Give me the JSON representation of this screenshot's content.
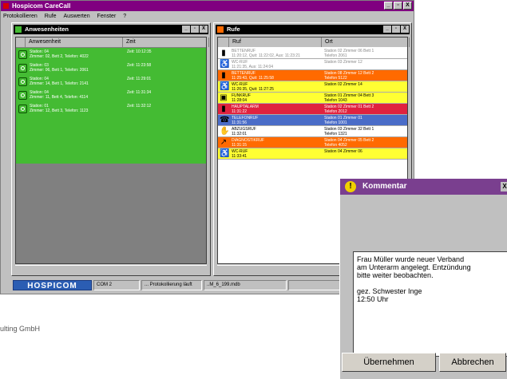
{
  "app": {
    "title": "Hospicom CareCall",
    "window_buttons": [
      "_",
      "▫",
      "X"
    ]
  },
  "menu": [
    "Protokollieren",
    "Rufe",
    "Auswerten",
    "Fenster",
    "?"
  ],
  "anwesenheiten": {
    "title": "Anwesenheiten",
    "columns": [
      "Anwesenheit",
      "Zeit"
    ],
    "rows": [
      {
        "line1": "Station: 04",
        "line2": "Zimmer: 02, Bett 2, Telefon: 4022",
        "time": "Zeit: 10:12:35"
      },
      {
        "line1": "Station: 03",
        "line2": "Zimmer: 06, Bett 1, Telefon: 2061",
        "time": "Zeit: 11:23:58"
      },
      {
        "line1": "Station: 04",
        "line2": "Zimmer: 14, Bett 1, Telefon: 2141",
        "time": "Zeit: 11:29:01"
      },
      {
        "line1": "Station: 04",
        "line2": "Zimmer: 11, Bett 4, Telefon: 4114",
        "time": "Zeit: 11:31:34"
      },
      {
        "line1": "Station: 01",
        "line2": "Zimmer: 12, Bett 3, Telefon: 1123",
        "time": "Zeit: 11:32:12"
      }
    ],
    "color": "#44bb33"
  },
  "rufe": {
    "title": "Rufe",
    "columns": [
      "Ruf",
      "Ort"
    ],
    "rows": [
      {
        "icon": "bed-icon",
        "glyph": "▮",
        "l1": "BETTENRUF",
        "l2": "11:20:12, Quit: 11:22:02, Aus: 11:23:21",
        "o1": "Station 02  Zimmer 06    Bett 1",
        "o2": "Telefon 2061",
        "bg": "#ffffff",
        "fg": "#888888"
      },
      {
        "icon": "toilet-icon",
        "glyph": "♿",
        "l1": "WC-RUF",
        "l2": "11:21:35, Aus: 11:24:04",
        "o1": "Station 03  Zimmer 12",
        "o2": "",
        "bg": "#ffffff",
        "fg": "#888888"
      },
      {
        "icon": "bed-icon",
        "glyph": "▮",
        "l1": "BETTENRUF",
        "l2": "11:25:43, Quit: 11:25:58",
        "o1": "Station 08  Zimmer 12    Bett 2",
        "o2": "Telefon 5122",
        "bg": "#ff6a00",
        "fg": "#ffffff"
      },
      {
        "icon": "toilet-icon",
        "glyph": "♿",
        "l1": "WC-RUF",
        "l2": "11:26:35, Quit: 11:27:25",
        "o1": "Station 02  Zimmer 14",
        "o2": "",
        "bg": "#ffff33",
        "fg": "#000000"
      },
      {
        "icon": "radio-icon",
        "glyph": "▣",
        "l1": "FUNKRUF",
        "l2": "11:28:04",
        "o1": "Station 01  Zimmer 04    Bett 3",
        "o2": "Telefon 1043",
        "bg": "#ffff33",
        "fg": "#000000"
      },
      {
        "icon": "alarm-icon",
        "glyph": "▮",
        "l1": "HAUPTALARM",
        "l2": "11:31:22",
        "o1": "Station 02  Zimmer 01    Bett 2",
        "o2": "Telefon 2012",
        "bg": "#e0223f",
        "fg": "#ffffff"
      },
      {
        "icon": "phone-icon",
        "glyph": "☎",
        "l1": "TELEFONRUF",
        "l2": "11:31:56",
        "o1": "Station 01  Zimmer 01",
        "o2": "Telefon 1001",
        "bg": "#4a6cc8",
        "fg": "#ffffff"
      },
      {
        "icon": "hand-icon",
        "glyph": "✋",
        "l1": "ABZUGSRUF",
        "l2": "11:32:01",
        "o1": "Station 03  Zimmer 32    Bett 1",
        "o2": "Telefon 1321",
        "bg": "#ffffff",
        "fg": "#000000"
      },
      {
        "icon": "chart-icon",
        "glyph": "↗",
        "l1": "DIAGNOSTIKRUF",
        "l2": "11:31:15",
        "o1": "Station 04  Zimmer 05    Bett 2",
        "o2": "Telefon 4052",
        "bg": "#ff6a00",
        "fg": "#ffffff"
      },
      {
        "icon": "toilet-icon",
        "glyph": "♿",
        "l1": "WC-RUF",
        "l2": "11:33:41",
        "o1": "Station 04  Zimmer 06",
        "o2": "",
        "bg": "#ffff33",
        "fg": "#000000"
      }
    ]
  },
  "status": {
    "logo": "HOSPICOM",
    "fields": [
      "COM 2",
      "... Protokollierung läuft",
      "..M_6_199.mdb"
    ]
  },
  "footer": "ulting GmbH",
  "dialog": {
    "title": "Kommentar",
    "text": "Frau Müller wurde neuer Verband\nam Unterarm angelegt. Entzündung\nbitte weiter beobachten.\n\ngez. Schwester Inge\n12:50 Uhr",
    "ok": "Übernehmen",
    "cancel": "Abbrechen"
  }
}
